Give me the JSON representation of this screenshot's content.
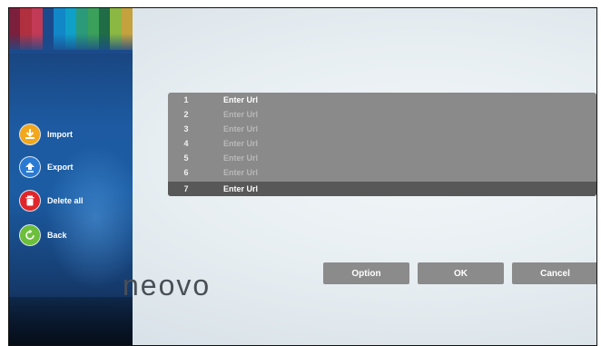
{
  "sidebar": {
    "stripe_colors": [
      "#7b1f3c",
      "#b03040",
      "#c23a55",
      "#1b4a8c",
      "#1287c8",
      "#0fa0c8",
      "#2a9a7a",
      "#3aa05a",
      "#1f6c46",
      "#8ab842",
      "#c4a23e"
    ],
    "items": [
      {
        "label": "Import",
        "icon": "download-icon",
        "color": "#f2a71c"
      },
      {
        "label": "Export",
        "icon": "upload-icon",
        "color": "#2a7ad3"
      },
      {
        "label": "Delete all",
        "icon": "trash-icon",
        "color": "#e0262a"
      },
      {
        "label": "Back",
        "icon": "back-arrow-icon",
        "color": "#6cbf3a"
      }
    ]
  },
  "url_list": {
    "rows": [
      {
        "number": "1",
        "text": "Enter Url"
      },
      {
        "number": "2",
        "text": "Enter Url"
      },
      {
        "number": "3",
        "text": "Enter Url"
      },
      {
        "number": "4",
        "text": "Enter Url"
      },
      {
        "number": "5",
        "text": "Enter Url"
      },
      {
        "number": "6",
        "text": "Enter Url"
      },
      {
        "number": "7",
        "text": "Enter Url"
      }
    ],
    "selected_number": "7"
  },
  "logo": {
    "text": "neovo"
  },
  "buttons": {
    "option": "Option",
    "ok": "OK",
    "cancel": "Cancel"
  }
}
